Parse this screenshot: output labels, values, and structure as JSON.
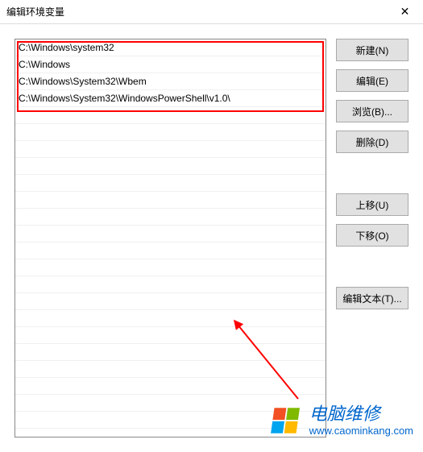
{
  "window": {
    "title": "编辑环境变量"
  },
  "paths": [
    "C:\\Windows\\system32",
    "C:\\Windows",
    "C:\\Windows\\System32\\Wbem",
    "C:\\Windows\\System32\\WindowsPowerShell\\v1.0\\"
  ],
  "buttons": {
    "new": "新建(N)",
    "edit": "编辑(E)",
    "browse": "浏览(B)...",
    "delete": "删除(D)",
    "moveUp": "上移(U)",
    "moveDown": "下移(O)",
    "editText": "编辑文本(T)..."
  },
  "watermark": {
    "line1": "电脑维修",
    "line2": "www.caominkang.com"
  }
}
